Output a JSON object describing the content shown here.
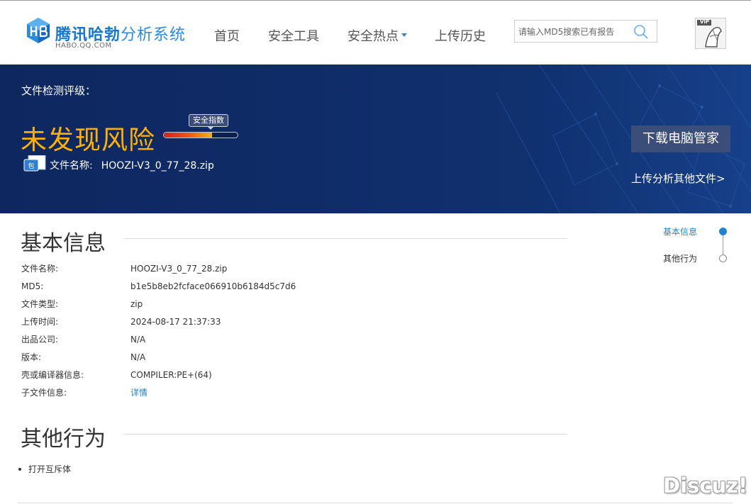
{
  "brand": {
    "title_strong": "腾讯哈勃",
    "title_light": "分析系统",
    "subtitle": "HABO.QQ.COM",
    "accent": "#1677d2"
  },
  "nav": {
    "items": [
      {
        "label": "首页"
      },
      {
        "label": "安全工具"
      },
      {
        "label": "安全热点",
        "has_dropdown": true
      },
      {
        "label": "上传历史"
      }
    ]
  },
  "search": {
    "placeholder": "请输入MD5搜索已有报告",
    "icon": "search-icon"
  },
  "user": {
    "avatar_badge": "VIP"
  },
  "hero": {
    "label": "文件检测评级：",
    "verdict": "未发现风险",
    "verdict_color": "#ffb000",
    "safety_tooltip": "安全指数",
    "safety_level_percent": 65,
    "file_icon_text": "包",
    "file_name_label": "文件名称:",
    "file_name": "HOOZI-V3_0_77_28.zip",
    "download_button": "下载电脑管家",
    "upload_link": "上传分析其他文件>",
    "background_color": "#0f2a66"
  },
  "basic_info": {
    "title": "基本信息",
    "rows": [
      {
        "key": "文件名称:",
        "value": "HOOZI-V3_0_77_28.zip"
      },
      {
        "key": "MD5:",
        "value": "b1e5b8eb2fcface066910b6184d5c7d6"
      },
      {
        "key": "文件类型:",
        "value": "zip"
      },
      {
        "key": "上传时间:",
        "value": "2024-08-17 21:37:33"
      },
      {
        "key": "出品公司:",
        "value": "N/A"
      },
      {
        "key": "版本:",
        "value": "N/A"
      },
      {
        "key": "壳或编译器信息:",
        "value": "COMPILER:PE+(64)"
      },
      {
        "key": "子文件信息:",
        "value": "详情",
        "is_link": true
      }
    ]
  },
  "other_behavior": {
    "title": "其他行为",
    "items": [
      "打开互斥体"
    ]
  },
  "side_nav": {
    "items": [
      {
        "label": "基本信息",
        "active": true
      },
      {
        "label": "其他行为",
        "active": false
      }
    ],
    "active_color": "#1f84cf"
  },
  "watermark": "Discuz!"
}
